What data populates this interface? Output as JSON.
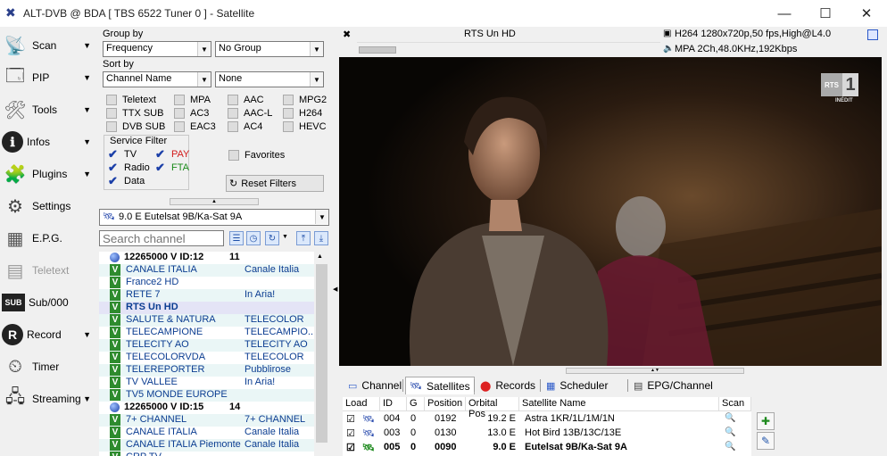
{
  "window": {
    "title": "ALT-DVB @ BDA [ TBS 6522 Tuner 0 ] - Satellite",
    "minimize": "—",
    "maximize": "☐",
    "close": "✕"
  },
  "sidebar": {
    "items": [
      {
        "label": "Scan",
        "icon": "satellite-dish-icon",
        "glyph": "📡",
        "arrow": "▼"
      },
      {
        "label": "PIP",
        "icon": "pip-icon",
        "glyph": "🗔",
        "arrow": "▼"
      },
      {
        "label": "Tools",
        "icon": "tools-icon",
        "glyph": "🛠",
        "arrow": "▼"
      },
      {
        "label": "Infos",
        "icon": "info-icon",
        "glyph": "ℹ",
        "arrow": "▼"
      },
      {
        "label": "Plugins",
        "icon": "plugin-icon",
        "glyph": "🧩",
        "arrow": "▼"
      },
      {
        "label": "Settings",
        "icon": "gear-icon",
        "glyph": "⚙",
        "arrow": ""
      },
      {
        "label": "E.P.G.",
        "icon": "epg-icon",
        "glyph": "▦",
        "arrow": ""
      },
      {
        "label": "Teletext",
        "icon": "teletext-icon",
        "glyph": "▤",
        "arrow": ""
      },
      {
        "label": "Sub/000",
        "icon": "subtitle-icon",
        "glyph": "SUB",
        "arrow": ""
      },
      {
        "label": "Record",
        "icon": "record-icon",
        "glyph": "R",
        "arrow": "▼"
      },
      {
        "label": "Timer",
        "icon": "timer-icon",
        "glyph": "⏲",
        "arrow": ""
      },
      {
        "label": "Streaming",
        "icon": "network-icon",
        "glyph": "🖧",
        "arrow": "▼"
      }
    ]
  },
  "filter": {
    "group_by_label": "Group by",
    "group_by_value": "Frequency",
    "group_by_value2": "No Group",
    "sort_by_label": "Sort by",
    "sort_by_value": "Channel Name",
    "sort_by_value2": "None",
    "checkboxes": [
      {
        "label": "Teletext"
      },
      {
        "label": "MPA"
      },
      {
        "label": "AAC"
      },
      {
        "label": "MPG2"
      },
      {
        "label": "TTX SUB"
      },
      {
        "label": "AC3"
      },
      {
        "label": "AAC-L"
      },
      {
        "label": "H264"
      },
      {
        "label": "DVB SUB"
      },
      {
        "label": "EAC3"
      },
      {
        "label": "AC4"
      },
      {
        "label": "HEVC"
      }
    ],
    "service_filter_label": "Service Filter",
    "service": {
      "tv": "TV",
      "pay": "PAY",
      "radio": "Radio",
      "fta": "FTA",
      "data": "Data"
    },
    "favorites_label": "Favorites",
    "reset_label": "Reset Filters"
  },
  "satellite_select": "9.0 E Eutelsat 9B/Ka-Sat 9A",
  "search": {
    "placeholder": "Search channel"
  },
  "channels": [
    {
      "group": true,
      "name": "12265000 V ID:12",
      "count": "11"
    },
    {
      "name": "CANALE ITALIA",
      "provider": "Canale Italia"
    },
    {
      "name": "France2 HD",
      "provider": ""
    },
    {
      "name": "RETE 7",
      "provider": "In Aria!"
    },
    {
      "name": "RTS Un HD",
      "provider": "",
      "selected": true
    },
    {
      "name": "SALUTE & NATURA",
      "provider": "TELECOLOR"
    },
    {
      "name": "TELECAMPIONE",
      "provider": "TELECAMPIO..."
    },
    {
      "name": "TELECITY AO",
      "provider": "TELECITY AO"
    },
    {
      "name": "TELECOLORVDA",
      "provider": "TELECOLOR"
    },
    {
      "name": "TELEREPORTER",
      "provider": "Pubblirose"
    },
    {
      "name": "TV VALLEE",
      "provider": "In Aria!"
    },
    {
      "name": "TV5 MONDE EUROPE",
      "provider": ""
    },
    {
      "group": true,
      "name": "12265000 V ID:15",
      "count": "14"
    },
    {
      "name": "7+ CHANNEL",
      "provider": "7+ CHANNEL"
    },
    {
      "name": "CANALE ITALIA",
      "provider": "Canale Italia"
    },
    {
      "name": "CANALE ITALIA Piemonte",
      "provider": "Canale Italia"
    },
    {
      "name": "CRP TV",
      "provider": ""
    }
  ],
  "player": {
    "channel_name": "RTS Un HD",
    "video_info": "H264 1280x720p,50 fps,High@L4.0",
    "audio_info": "MPA 2Ch,48.0KHz,192Kbps",
    "logo_text": "RTS",
    "logo_number": "1",
    "logo_sub": "INÉDIT"
  },
  "tabs": [
    {
      "label": "Channel",
      "active": false
    },
    {
      "label": "Satellites",
      "active": true
    },
    {
      "label": "Records",
      "active": false
    },
    {
      "label": "Scheduler",
      "active": false
    },
    {
      "label": "EPG/Channel",
      "active": false
    }
  ],
  "sat_table": {
    "headers": [
      "Load",
      "ID",
      "G",
      "Position",
      "Orbital Pos",
      "Satellite Name",
      "Scan"
    ],
    "rows": [
      {
        "load": "☑",
        "id": "004",
        "g": "0",
        "position": "0192",
        "orbital": "19.2 E",
        "name": "Astra 1KR/1L/1M/1N",
        "bold": false
      },
      {
        "load": "☑",
        "id": "003",
        "g": "0",
        "position": "0130",
        "orbital": "13.0 E",
        "name": "Hot Bird 13B/13C/13E",
        "bold": false
      },
      {
        "load": "☑",
        "id": "005",
        "g": "0",
        "position": "0090",
        "orbital": "9.0 E",
        "name": "Eutelsat 9B/Ka-Sat 9A",
        "bold": true
      }
    ]
  }
}
